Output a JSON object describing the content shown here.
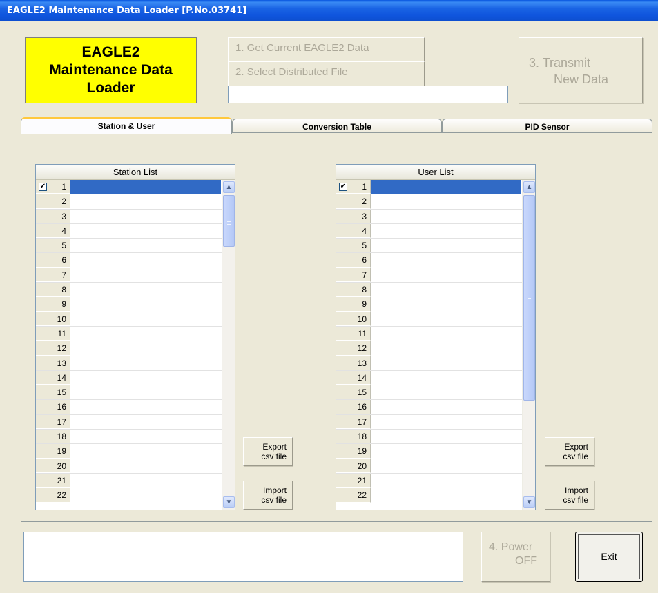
{
  "window": {
    "title": "EAGLE2 Maintenance Data Loader [P.No.03741]"
  },
  "logo": {
    "line1": "EAGLE2",
    "line2": "Maintenance Data",
    "line3": "Loader",
    "bg_color": "#ffff00"
  },
  "toolbar": {
    "get_current_label": "1. Get Current EAGLE2 Data",
    "select_file_label": "2. Select Distributed File",
    "file_path_value": "",
    "transmit_line1": "3. Transmit",
    "transmit_line2": "New Data"
  },
  "tabs": [
    {
      "label": "Station & User",
      "active": true
    },
    {
      "label": "Conversion Table",
      "active": false
    },
    {
      "label": "PID Sensor",
      "active": false
    }
  ],
  "station_list": {
    "header": "Station List",
    "rows": [
      "1",
      "2",
      "3",
      "4",
      "5",
      "6",
      "7",
      "8",
      "9",
      "10",
      "11",
      "12",
      "13",
      "14",
      "15",
      "16",
      "17",
      "18",
      "19",
      "20",
      "21",
      "22"
    ],
    "checked_row": "1",
    "check_mark": "✔"
  },
  "user_list": {
    "header": "User List",
    "rows": [
      "1",
      "2",
      "3",
      "4",
      "5",
      "6",
      "7",
      "8",
      "9",
      "10",
      "11",
      "12",
      "13",
      "14",
      "15",
      "16",
      "17",
      "18",
      "19",
      "20",
      "21",
      "22"
    ],
    "checked_row": "1",
    "check_mark": "✔"
  },
  "csv_buttons": {
    "export_line1": "Export",
    "export_line2": "csv file",
    "import_line1": "Import",
    "import_line2": "csv file"
  },
  "footer": {
    "status_text": "",
    "power_line1": "4. Power",
    "power_line2": "OFF",
    "exit_label": "Exit"
  },
  "icons": {
    "scroll_up": "scroll-up-arrow-icon",
    "scroll_down": "scroll-down-arrow-icon",
    "checkbox": "checkbox-checked-icon"
  },
  "colors": {
    "selection": "#316ac5",
    "titlebar": "#0d4fd0",
    "disabled_text": "#aca899"
  }
}
